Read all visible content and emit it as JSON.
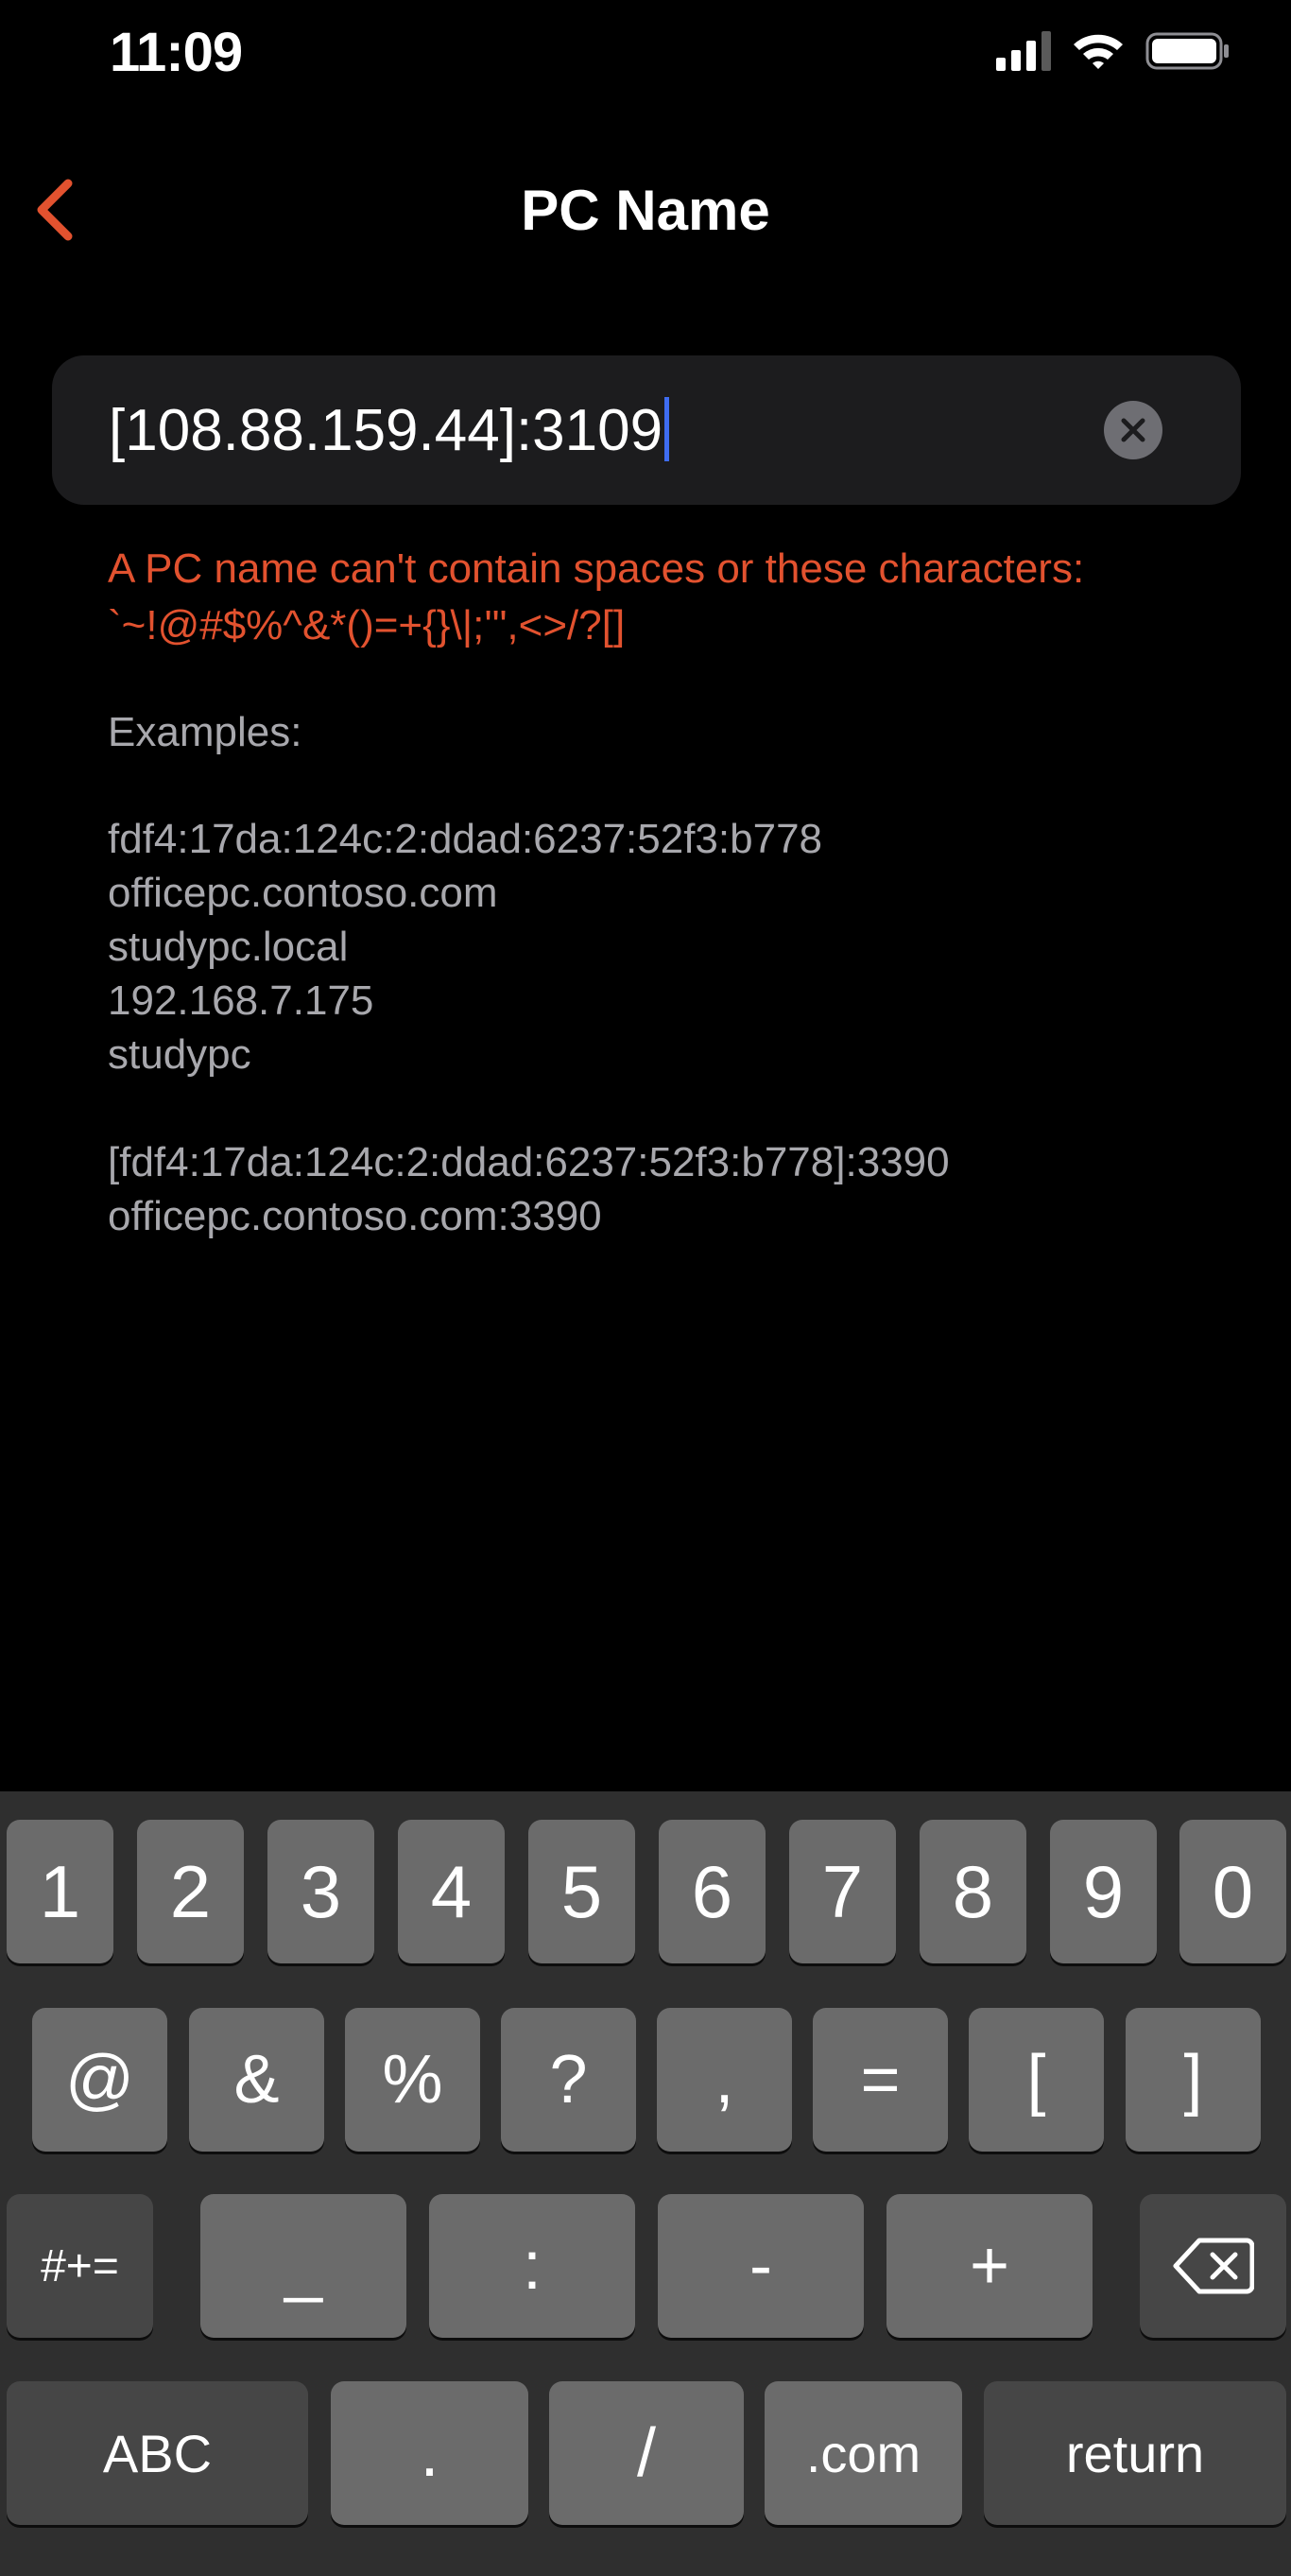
{
  "status_bar": {
    "time": "11:09",
    "icons": [
      "signal-icon",
      "wifi-icon",
      "battery-icon"
    ]
  },
  "nav": {
    "title": "PC Name",
    "back_icon": "chevron-left-icon",
    "accent_color": "#e2522f"
  },
  "pc_name_field": {
    "value": "[108.88.159.44]:3109",
    "clear_icon": "clear-icon"
  },
  "help": {
    "error_line1": "A PC name can't contain spaces or these characters:",
    "error_line2": "`~!@#$%^&*()=+{}\\|;'\",<>/?[]",
    "examples_label": "Examples:",
    "examples": [
      "fdf4:17da:124c:2:ddad:6237:52f3:b778",
      "officepc.contoso.com",
      "studypc.local",
      "192.168.7.175",
      "studypc"
    ],
    "port_examples": [
      "[fdf4:17da:124c:2:ddad:6237:52f3:b778]:3390",
      "officepc.contoso.com:3390"
    ]
  },
  "keyboard": {
    "row1": [
      "1",
      "2",
      "3",
      "4",
      "5",
      "6",
      "7",
      "8",
      "9",
      "0"
    ],
    "row2": [
      "@",
      "&",
      "%",
      "?",
      ",",
      "=",
      "[",
      "]"
    ],
    "row3": [
      "#+=",
      "_",
      ":",
      "-",
      "+"
    ],
    "row3_delete_icon": "backspace-icon",
    "row4": [
      "ABC",
      ".",
      "/",
      ".com",
      "return"
    ]
  }
}
